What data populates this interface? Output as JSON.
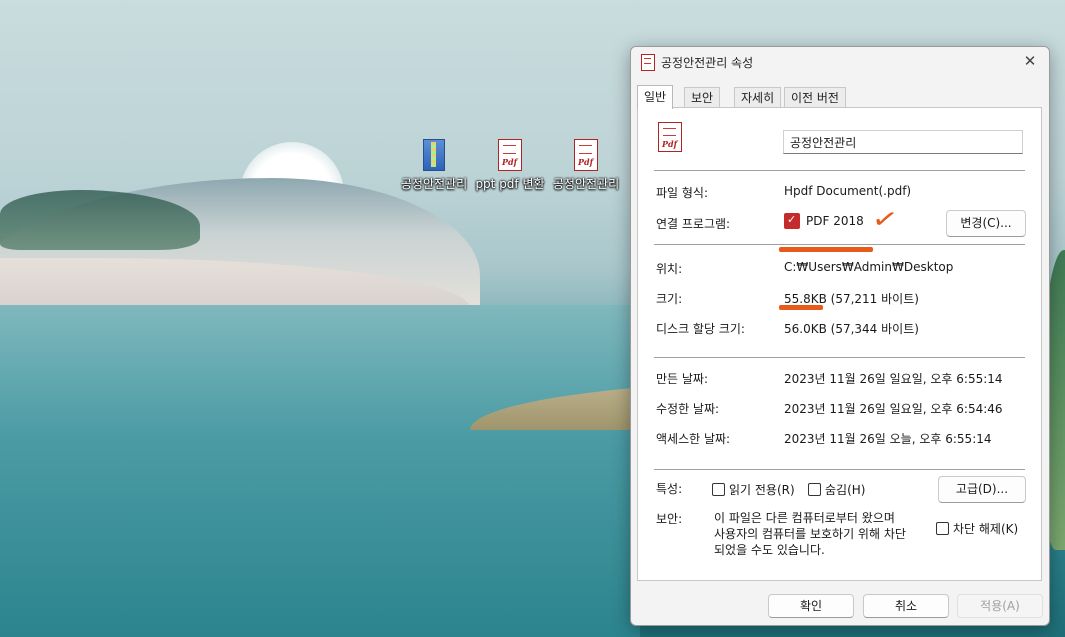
{
  "desktop": {
    "icons": [
      {
        "label": "공정안전관리",
        "icon": "archive-icon"
      },
      {
        "label": "ppt pdf 변환",
        "icon": "pdf-file-icon"
      },
      {
        "label": "공정안전관리",
        "icon": "pdf-file-icon"
      }
    ]
  },
  "dialog": {
    "title": "공정안전관리 속성",
    "tabs": [
      "일반",
      "보안",
      "자세히",
      "이전 버전"
    ],
    "active_tab": "일반",
    "file_name": "공정안전관리",
    "rows": {
      "file_type_label": "파일 형식:",
      "file_type_value": "Hpdf Document(.pdf)",
      "opens_with_label": "연결 프로그램:",
      "opens_with_value": "PDF 2018",
      "change_button": "변경(C)...",
      "location_label": "위치:",
      "location_value": "C:₩Users₩Admin₩Desktop",
      "size_label": "크기:",
      "size_value": "55.8KB (57,211 바이트)",
      "disk_size_label": "디스크 할당 크기:",
      "disk_size_value": "56.0KB (57,344 바이트)",
      "created_label": "만든 날짜:",
      "created_value": "2023년 11월 26일 일요일, 오후 6:55:14",
      "modified_label": "수정한 날짜:",
      "modified_value": "2023년 11월 26일 일요일, 오후 6:54:46",
      "accessed_label": "액세스한 날짜:",
      "accessed_value": "2023년 11월 26일 오늘, 오후 6:55:14",
      "attributes_label": "특성:",
      "readonly_label": "읽기 전용(R)",
      "hidden_label": "숨김(H)",
      "advanced_button": "고급(D)...",
      "security_label": "보안:",
      "security_text_1": "이 파일은 다른 컴퓨터로부터 왔으며",
      "security_text_2": "사용자의 컴퓨터를 보호하기 위해 차단",
      "security_text_3": "되었을 수도 있습니다.",
      "unblock_label": "차단 해제(K)"
    },
    "footer": {
      "ok": "확인",
      "cancel": "취소",
      "apply": "적용(A)"
    }
  },
  "colors": {
    "annotation": "#e85a1c",
    "pdf_red": "#b02424"
  }
}
